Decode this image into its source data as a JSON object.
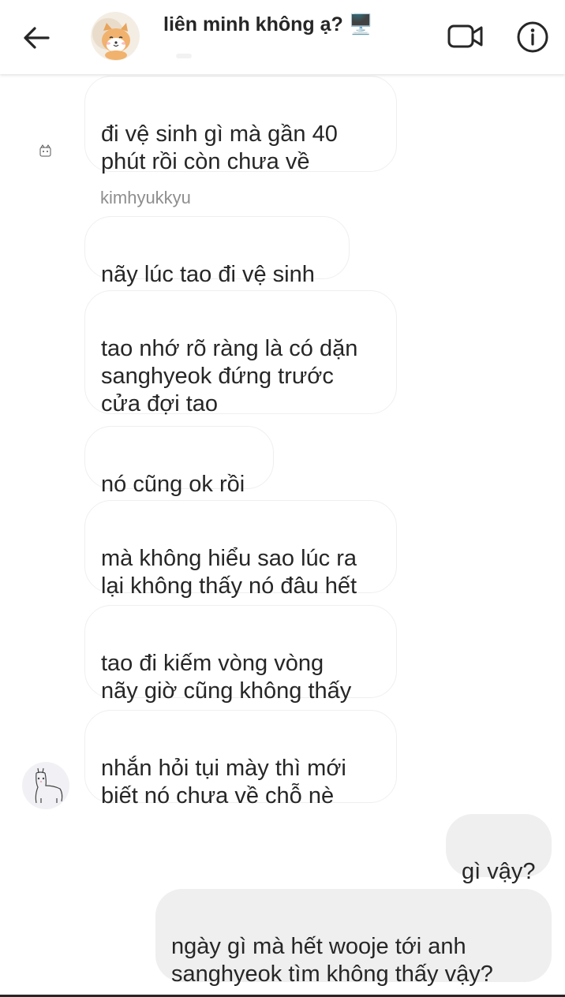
{
  "header": {
    "title": "liên minh không ạ? 🖥️",
    "back_icon": "arrow-left-icon",
    "video_icon": "video-call-icon",
    "info_icon": "info-icon",
    "avatar": "shiba-dog-avatar"
  },
  "thread": {
    "sender_name": "kimhyukkyu",
    "messages_before_name": [
      {
        "text": "đi vệ sinh gì mà gần 40\nphút rồi còn chưa về"
      }
    ],
    "messages_incoming": [
      {
        "text": "nãy lúc tao đi vệ sinh"
      },
      {
        "text": "tao nhớ rõ ràng là có dặn\nsanghyeok đứng trước\ncửa đợi tao"
      },
      {
        "text": "nó cũng ok rồi"
      },
      {
        "text": "mà không hiểu sao lúc ra\nlại không thấy nó đâu hết"
      },
      {
        "text": "tao đi kiếm vòng vòng\nnãy giờ cũng không thấy"
      },
      {
        "text": "nhắn hỏi tụi mày thì mới\nbiết nó chưa về chỗ nè"
      }
    ],
    "messages_outgoing": [
      {
        "text": "gì vậy?"
      },
      {
        "text": "ngày gì mà hết wooje tới anh\nsanghyeok tìm không thấy vậy?"
      }
    ]
  },
  "colors": {
    "incoming_border": "#efefef",
    "outgoing_bg": "#efefef",
    "text": "#262626",
    "muted": "#8e8e8e"
  }
}
